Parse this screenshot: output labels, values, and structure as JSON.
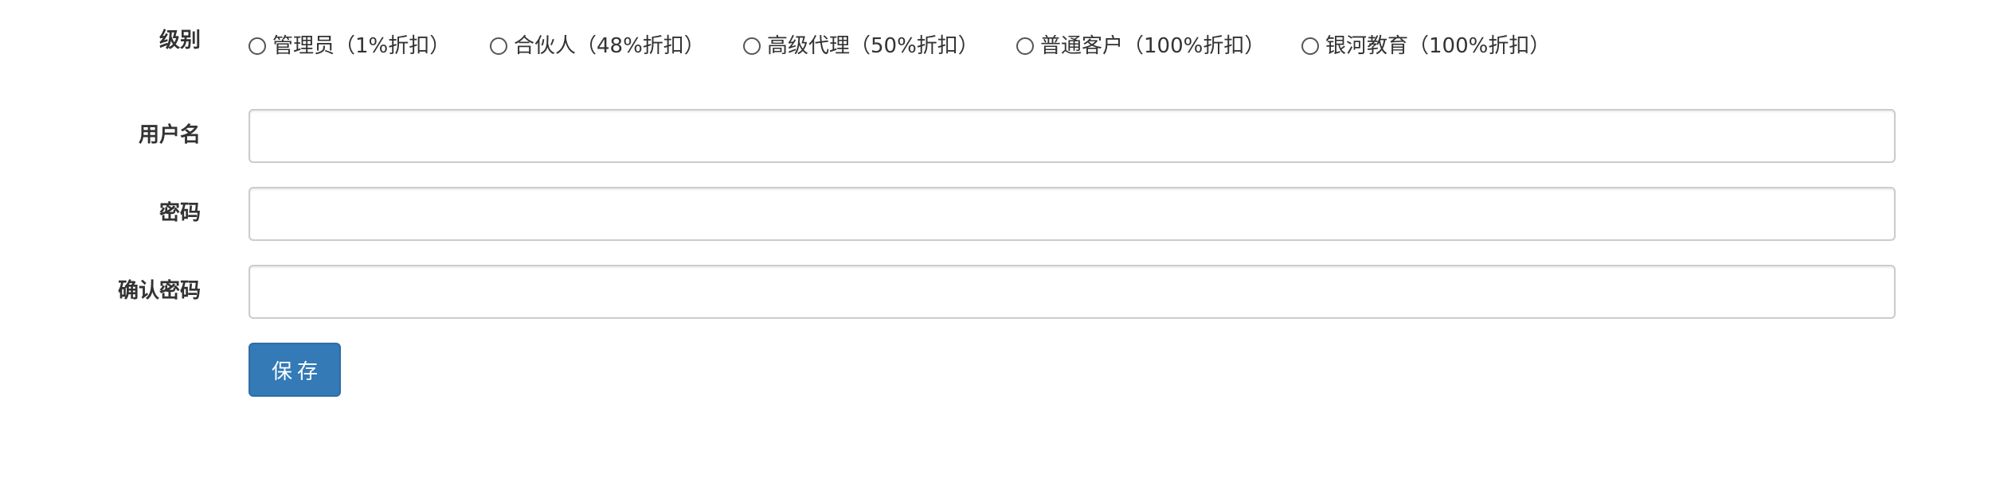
{
  "level": {
    "label": "级别",
    "options": [
      {
        "label": "管理员（1%折扣）",
        "selected": false
      },
      {
        "label": "合伙人（48%折扣）",
        "selected": false
      },
      {
        "label": "高级代理（50%折扣）",
        "selected": false
      },
      {
        "label": "普通客户（100%折扣）",
        "selected": false
      },
      {
        "label": "银河教育（100%折扣）",
        "selected": false
      }
    ]
  },
  "username": {
    "label": "用户名",
    "value": "",
    "placeholder": ""
  },
  "password": {
    "label": "密码",
    "value": "",
    "placeholder": ""
  },
  "confirm_password": {
    "label": "确认密码",
    "value": "",
    "placeholder": ""
  },
  "actions": {
    "save_label": "保存"
  },
  "colors": {
    "primary": "#337ab7",
    "primary_border": "#2e6da4",
    "input_border": "#cccccc",
    "text": "#333333"
  }
}
